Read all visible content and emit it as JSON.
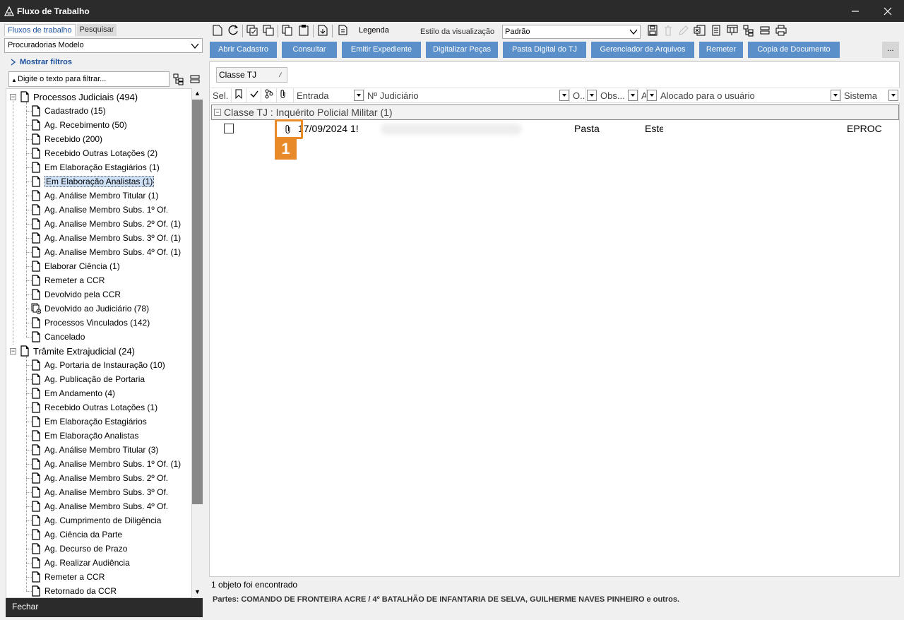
{
  "window": {
    "title": "Fluxo de Trabalho"
  },
  "left_panel": {
    "tabs": [
      "Fluxos de trabalho",
      "Pesquisar"
    ],
    "active_tab": 0,
    "selector_value": "Procuradorias Modelo",
    "show_filters_label": "Mostrar filtros",
    "filter_placeholder": "Digite o texto para filtrar...",
    "tree": [
      {
        "label": "Processos Judiciais (494)",
        "level": 0
      },
      {
        "label": "Cadastrado (15)",
        "level": 1
      },
      {
        "label": "Ag. Recebimento (50)",
        "level": 1
      },
      {
        "label": "Recebido (200)",
        "level": 1
      },
      {
        "label": "Recebido Outras Lotações (2)",
        "level": 1
      },
      {
        "label": "Em Elaboração Estagiários (1)",
        "level": 1
      },
      {
        "label": "Em Elaboração Analistas (1)",
        "level": 1,
        "selected": true
      },
      {
        "label": "Ag. Análise Membro Titular (1)",
        "level": 1
      },
      {
        "label": "Ag. Analise Membro Subs. 1º Of.",
        "level": 1
      },
      {
        "label": "Ag. Analise Membro Subs. 2º Of. (1)",
        "level": 1
      },
      {
        "label": "Ag. Analise Membro Subs. 3º Of. (1)",
        "level": 1
      },
      {
        "label": "Ag. Analise Membro Subs. 4º Of. (1)",
        "level": 1
      },
      {
        "label": "Elaborar Ciência (1)",
        "level": 1
      },
      {
        "label": "Remeter a CCR",
        "level": 1
      },
      {
        "label": "Devolvido pela CCR",
        "level": 1
      },
      {
        "label": "Devolvido ao Judiciário (78)",
        "level": 1,
        "icon": "stacked-doc-icon"
      },
      {
        "label": "Processos Vinculados (142)",
        "level": 1
      },
      {
        "label": "Cancelado",
        "level": 1
      },
      {
        "label": "Trâmite Extrajudicial (24)",
        "level": 0
      },
      {
        "label": "Ag. Portaria de Instauração (10)",
        "level": 1
      },
      {
        "label": "Ag. Publicação de Portaria",
        "level": 1
      },
      {
        "label": "Em Andamento (4)",
        "level": 1
      },
      {
        "label": "Recebido Outras Lotações (1)",
        "level": 1
      },
      {
        "label": "Em Elaboração Estagiários",
        "level": 1
      },
      {
        "label": "Em Elaboração Analistas",
        "level": 1
      },
      {
        "label": "Ag. Análise Membro Titular (3)",
        "level": 1
      },
      {
        "label": "Ag. Analise Membro Subs. 1º Of. (1)",
        "level": 1
      },
      {
        "label": "Ag. Analise Membro Subs. 2º Of.",
        "level": 1
      },
      {
        "label": "Ag. Analise Membro Subs. 3º Of.",
        "level": 1
      },
      {
        "label": "Ag. Analise Membro Subs. 4º Of.",
        "level": 1
      },
      {
        "label": "Ag. Cumprimento de Diligência",
        "level": 1
      },
      {
        "label": "Ag. Ciência da Parte",
        "level": 1
      },
      {
        "label": "Ag. Decurso de Prazo",
        "level": 1
      },
      {
        "label": "Ag. Realizar Audiência",
        "level": 1
      },
      {
        "label": "Remeter a CCR",
        "level": 1
      },
      {
        "label": "Retornado da CCR",
        "level": 1
      }
    ],
    "close_label": "Fechar"
  },
  "toolbar": {
    "legend_label": "Legenda",
    "view_style_label": "Estilo da visualização",
    "view_style_value": "Padrão"
  },
  "actions": [
    "Abrir Cadastro",
    "Consultar",
    "Emitir Expediente",
    "Digitalizar Peças",
    "Pasta Digital do TJ",
    "Gerenciador de Arquivos",
    "Remeter",
    "Copia de Documento"
  ],
  "more_label": "...",
  "grid": {
    "group_by_label": "Classe TJ",
    "columns": [
      "Sel.",
      "Entrada",
      "Nº Judiciário",
      "O...",
      "Obs...",
      "A",
      "Alocado para o usuário",
      "Sistema"
    ],
    "group_row": "Classe TJ : Inquérito Policial Militar  (1)",
    "rows": [
      {
        "entrada": "17/09/2024 1!",
        "col_o": "Pasta",
        "col_obs": "Este",
        "sistema": "EPROC"
      }
    ]
  },
  "callout": {
    "number": "1"
  },
  "status": {
    "count_text": "1 objeto foi encontrado",
    "parties_text": "Partes: COMANDO DE FRONTEIRA ACRE / 4º BATALHÃO DE INFANTARIA DE SELVA, GUILHERME NAVES PINHEIRO e outros."
  },
  "colors": {
    "accent_button": "#5b8fc9",
    "title_bar": "#2b2b2b",
    "callout": "#e8892a",
    "link": "#1a4f9c"
  }
}
